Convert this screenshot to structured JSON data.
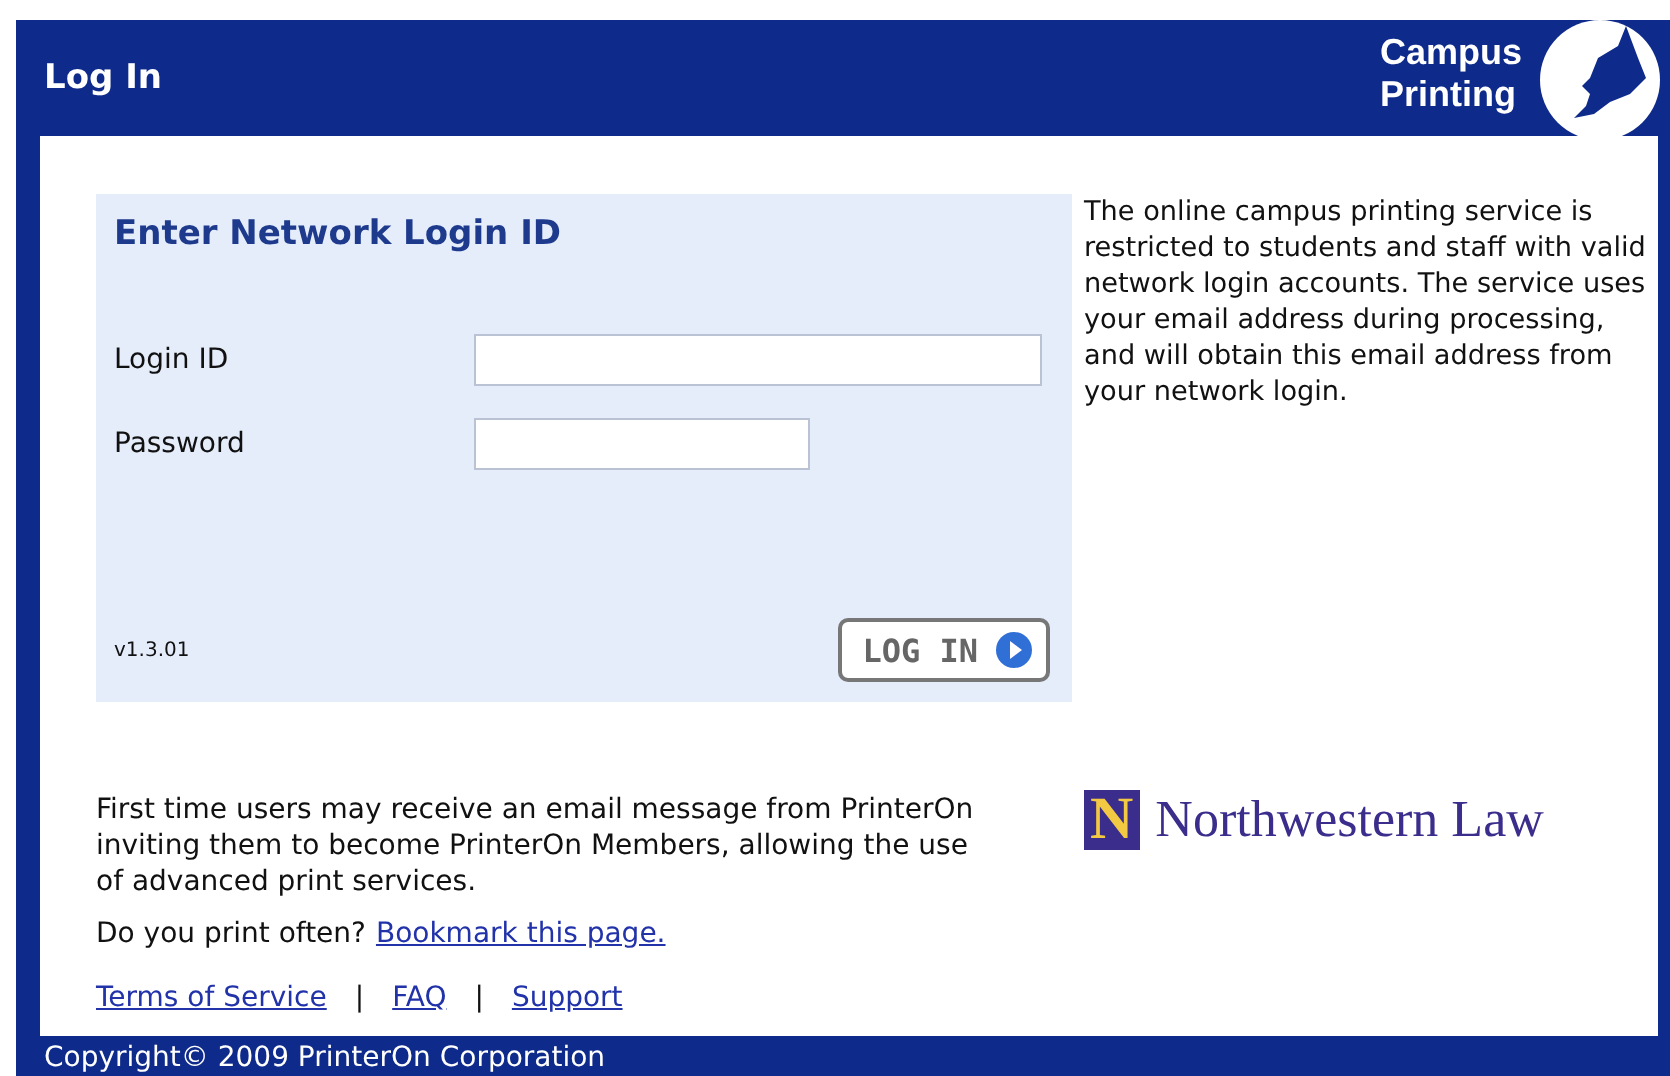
{
  "header": {
    "title": "Log In",
    "brand_lines": [
      "Campus",
      "Printing"
    ]
  },
  "login_panel": {
    "heading": "Enter Network Login ID",
    "fields": [
      {
        "label": "Login ID",
        "kind": "wide"
      },
      {
        "label": "Password",
        "kind": "narrow"
      }
    ],
    "version": "v1.3.01",
    "button": "LOG IN"
  },
  "info": "The online campus printing service is restricted to students and staff with valid network login accounts. The service uses your email address during processing, and will obtain this email address from your network login.",
  "notice": "First time users may receive an email message from PrinterOn inviting them to become PrinterOn Members, allowing the use of advanced print services.",
  "bookmark": {
    "text": "Do you print often?",
    "link": "Bookmark this page."
  },
  "links": [
    {
      "label": "Terms of Service"
    },
    {
      "label": "FAQ"
    },
    {
      "label": "Support"
    }
  ],
  "separator": "|",
  "school_logo": {
    "mark": "N",
    "name": "Northwestern",
    "suffix": "Law"
  },
  "footer": "Copyright© 2009 PrinterOn Corporation"
}
